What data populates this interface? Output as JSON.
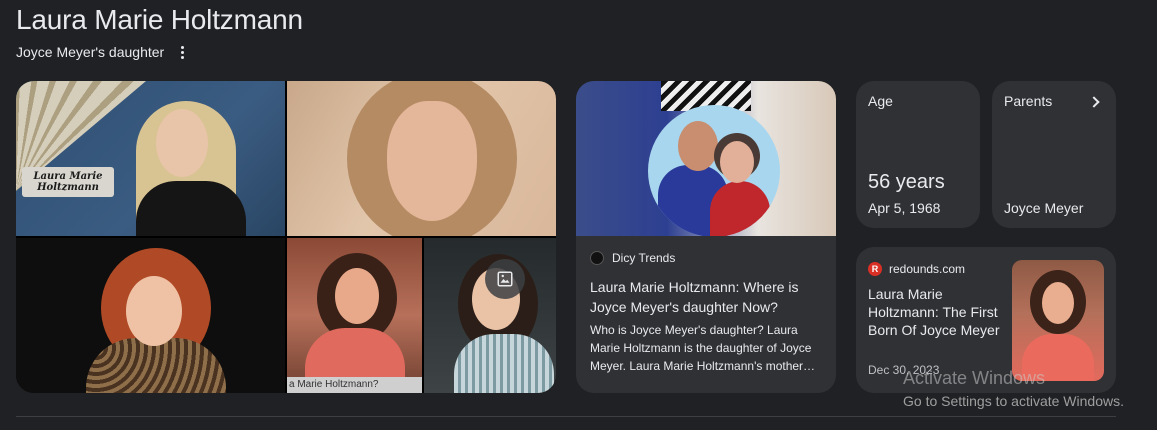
{
  "header": {
    "title": "Laura Marie Holtzmann",
    "subtitle": "Joyce Meyer's daughter",
    "more_icon": "more-vert-icon"
  },
  "images": {
    "tile1_name_card": "Laura Marie Holtzmann",
    "tile4_caption": "a Marie Holtzmann?",
    "image_search_icon": "image-icon"
  },
  "article": {
    "source": "Dicy Trends",
    "title": "Laura Marie Holtzmann: Where is Joyce Meyer's daughter Now?",
    "snippet": "Who is Joyce Meyer's daughter? Laura Marie Holtzmann is the daughter of Joyce Meyer. Laura Marie Holtzmann's mother…"
  },
  "facts": {
    "age": {
      "label": "Age",
      "value": "56 years",
      "sub": "Apr 5, 1968"
    },
    "parents": {
      "label": "Parents",
      "value": "Joyce Meyer",
      "icon": "chevron-right-icon"
    }
  },
  "news": {
    "source": "redounds.com",
    "favicon_letter": "R",
    "title": "Laura Marie Holtzmann: The First Born Of Joyce Meyer",
    "date": "Dec 30, 2023"
  },
  "watermark": {
    "line1": "Activate Windows",
    "line2": "Go to Settings to activate Windows."
  },
  "colors": {
    "background": "#202124",
    "card": "#303134",
    "text": "#e8eaed"
  }
}
